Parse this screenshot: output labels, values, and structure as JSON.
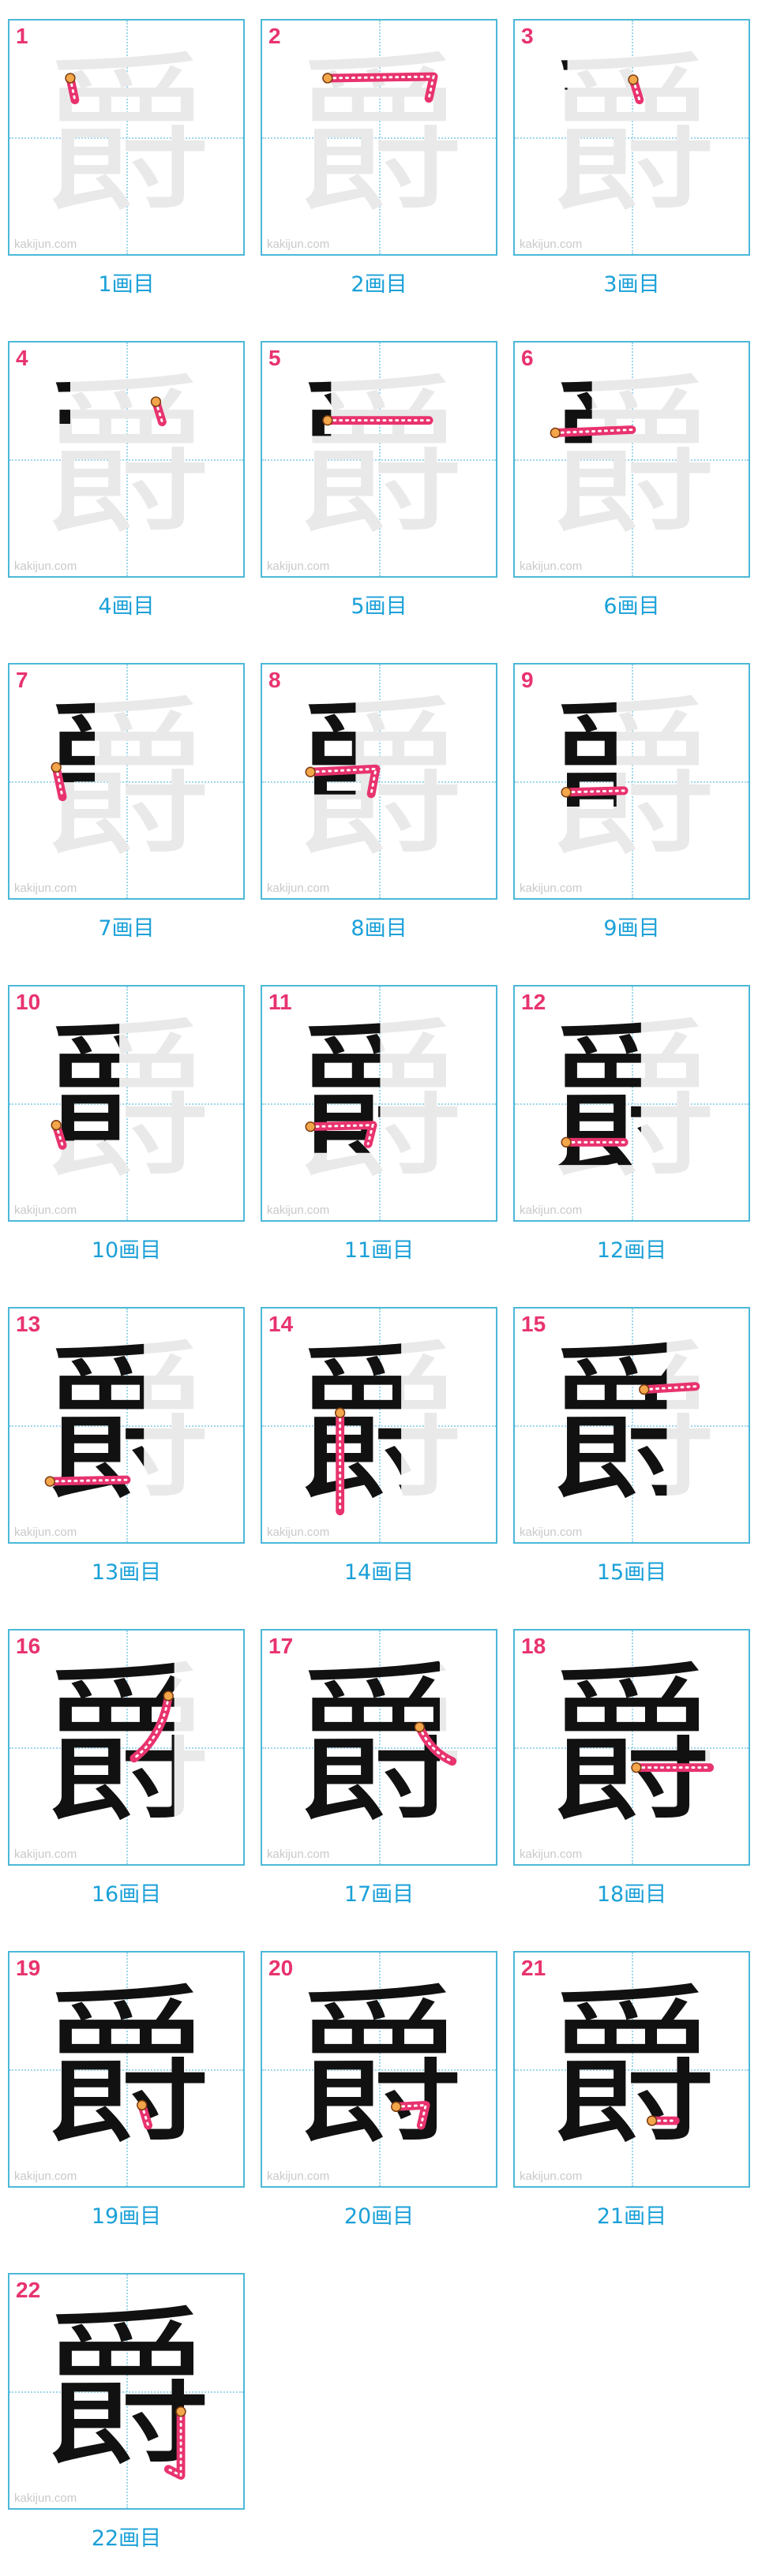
{
  "character": "爵",
  "watermark": "kakijun.com",
  "colors": {
    "border": "#4cb8d8",
    "number": "#e8336e",
    "caption": "#1aa0d8",
    "highlight": "#e8336e",
    "ghost": "#e9e9e9",
    "ink": "#111111"
  },
  "steps": [
    {
      "number": "1",
      "caption": "1画目"
    },
    {
      "number": "2",
      "caption": "2画目"
    },
    {
      "number": "3",
      "caption": "3画目"
    },
    {
      "number": "4",
      "caption": "4画目"
    },
    {
      "number": "5",
      "caption": "5画目"
    },
    {
      "number": "6",
      "caption": "6画目"
    },
    {
      "number": "7",
      "caption": "7画目"
    },
    {
      "number": "8",
      "caption": "8画目"
    },
    {
      "number": "9",
      "caption": "9画目"
    },
    {
      "number": "10",
      "caption": "10画目"
    },
    {
      "number": "11",
      "caption": "11画目"
    },
    {
      "number": "12",
      "caption": "12画目"
    },
    {
      "number": "13",
      "caption": "13画目"
    },
    {
      "number": "14",
      "caption": "14画目"
    },
    {
      "number": "15",
      "caption": "15画目"
    },
    {
      "number": "16",
      "caption": "16画目"
    },
    {
      "number": "17",
      "caption": "17画目"
    },
    {
      "number": "18",
      "caption": "18画目"
    },
    {
      "number": "19",
      "caption": "19画目"
    },
    {
      "number": "20",
      "caption": "20画目"
    },
    {
      "number": "21",
      "caption": "21画目"
    },
    {
      "number": "22",
      "caption": "22画目"
    }
  ]
}
